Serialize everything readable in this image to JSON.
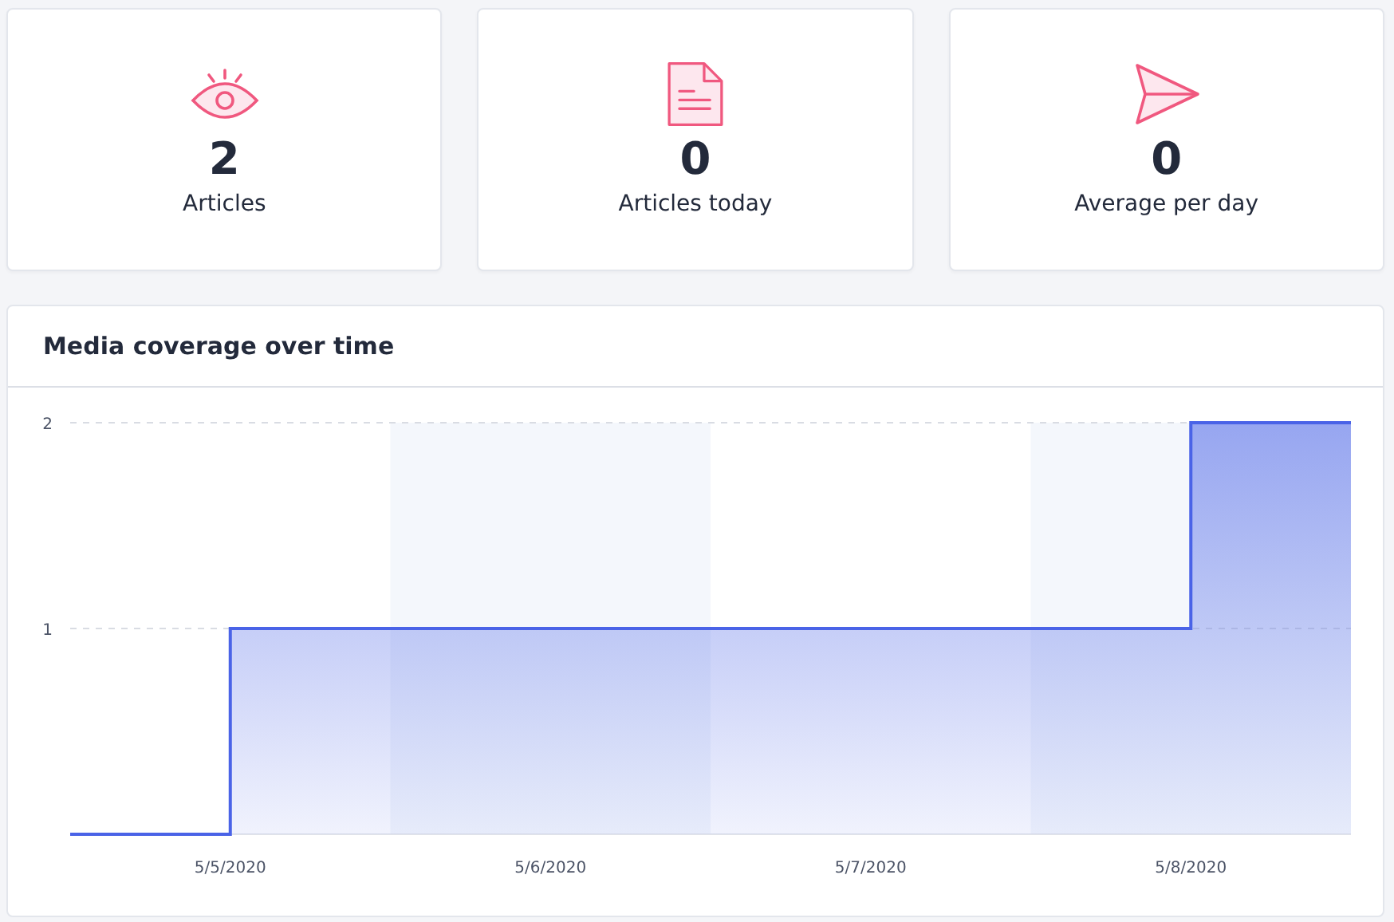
{
  "stats": [
    {
      "kind": "eye",
      "value": "2",
      "label": "Articles"
    },
    {
      "kind": "document",
      "value": "0",
      "label": "Articles today"
    },
    {
      "kind": "plane",
      "value": "0",
      "label": "Average per day"
    }
  ],
  "coverage": {
    "title": "Media coverage over time",
    "chart_data": {
      "type": "area",
      "categories": [
        null,
        "5/5/2020",
        null,
        "5/6/2020",
        null,
        "5/7/2020",
        null,
        "5/8/2020",
        null
      ],
      "yticks": [
        1,
        2
      ],
      "ylim": [
        0,
        2
      ],
      "series": [
        {
          "color": "#4a63e7",
          "values": [
            0,
            1,
            1,
            1,
            1,
            1,
            1,
            2,
            2
          ]
        }
      ]
    }
  }
}
